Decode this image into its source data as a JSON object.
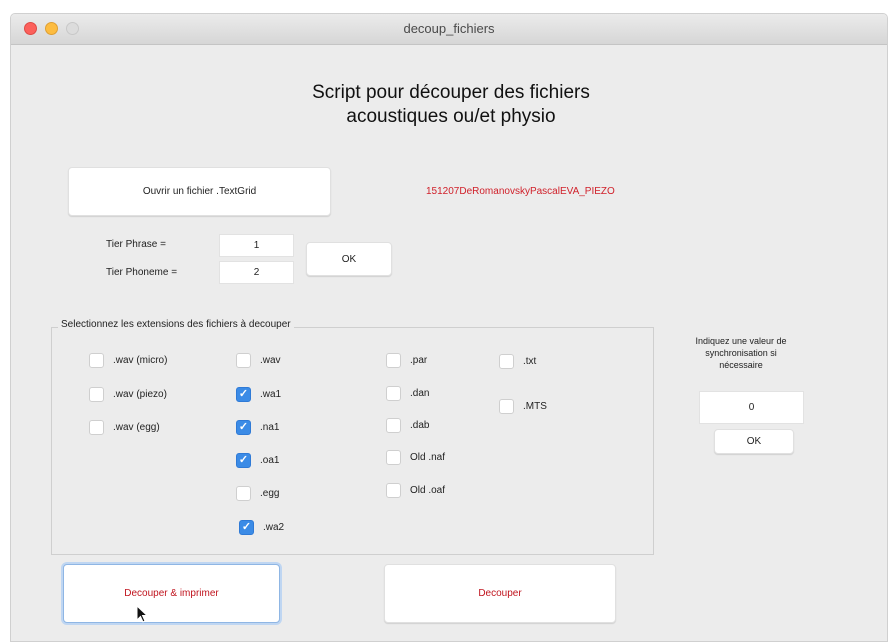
{
  "window": {
    "title": "decoup_fichiers"
  },
  "heading": {
    "line1": "Script pour découper des fichiers",
    "line2": "acoustiques ou/et physio"
  },
  "open_button": {
    "label": "Ouvrir un fichier .TextGrid"
  },
  "loaded_file": {
    "name": "151207DeRomanovskyPascalEVA_PIEZO"
  },
  "tiers": {
    "phrase_label": "Tier Phrase =",
    "phrase_value": "1",
    "phoneme_label": "Tier Phoneme =",
    "phoneme_value": "2",
    "ok_label": "OK"
  },
  "extensions": {
    "title": "Selectionnez les extensions des fichiers à decouper",
    "items": [
      {
        "label": ".wav (micro)",
        "checked": false
      },
      {
        "label": ".wav (piezo)",
        "checked": false
      },
      {
        "label": ".wav (egg)",
        "checked": false
      },
      {
        "label": ".wav",
        "checked": false
      },
      {
        "label": ".wa1",
        "checked": true
      },
      {
        "label": ".na1",
        "checked": true
      },
      {
        "label": ".oa1",
        "checked": true
      },
      {
        "label": ".egg",
        "checked": false
      },
      {
        "label": ".wa2",
        "checked": true
      },
      {
        "label": ".par",
        "checked": false
      },
      {
        "label": ".dan",
        "checked": false
      },
      {
        "label": ".dab",
        "checked": false
      },
      {
        "label": "Old .naf",
        "checked": false
      },
      {
        "label": "Old .oaf",
        "checked": false
      },
      {
        "label": ".txt",
        "checked": false
      },
      {
        "label": ".MTS",
        "checked": false
      }
    ]
  },
  "sync": {
    "label_line1": "Indiquez une valeur de",
    "label_line2": "synchronisation si",
    "label_line3": "nécessaire",
    "value": "0",
    "ok_label": "OK"
  },
  "actions": {
    "cut_print_label": "Decouper & imprimer",
    "cut_label": "Decouper"
  }
}
